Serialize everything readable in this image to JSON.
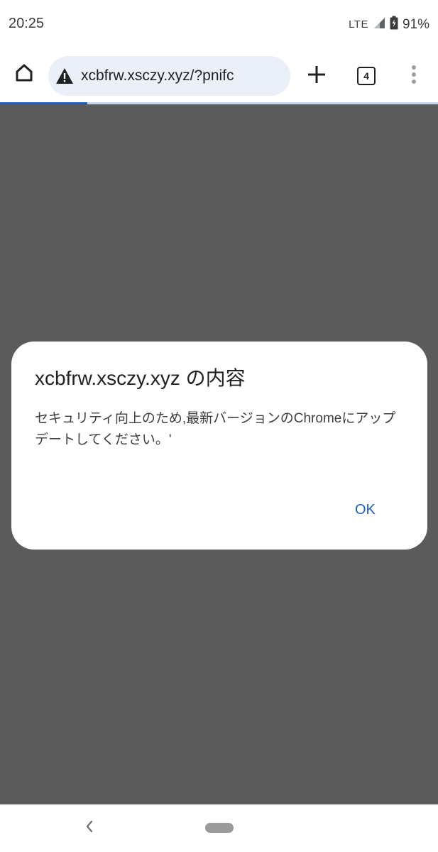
{
  "status_bar": {
    "time": "20:25",
    "network": "LTE",
    "battery": "91%"
  },
  "toolbar": {
    "url": "xcbfrw.xsczy.xyz/?pnifc",
    "tab_count": "4",
    "icons": [
      "home-icon",
      "warning-icon",
      "plus-icon",
      "tab-switcher-icon",
      "more-vert-icon"
    ]
  },
  "page_load_progress": 0.2,
  "dialog": {
    "title": "xcbfrw.xsczy.xyz の内容",
    "message": "セキュリティ向上のため,最新バージョンのChromeにアップデートしてください。'",
    "ok_label": "OK"
  },
  "colors": {
    "accent": "#1a5fc4",
    "scrim": "#5b5b5b",
    "omnibox": "#eaeff8"
  }
}
